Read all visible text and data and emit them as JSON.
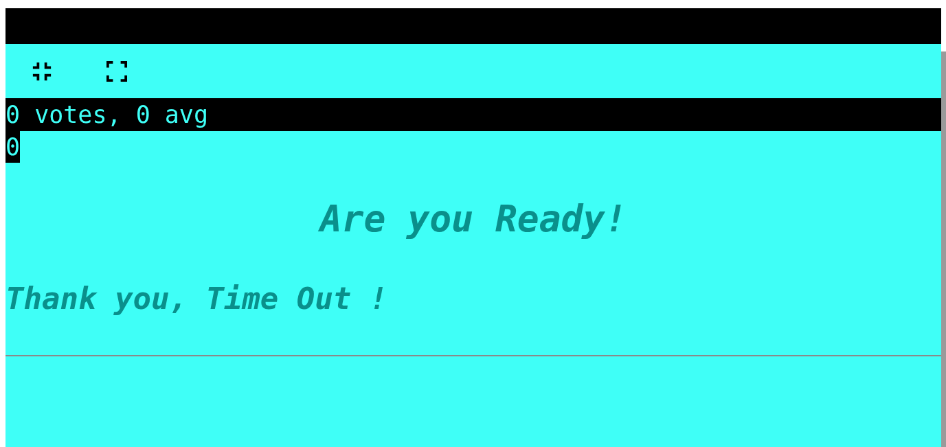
{
  "stats": "0 votes, 0 avg",
  "counter": "0",
  "heading": "Are you Ready!",
  "message": "Thank you, Time Out !"
}
